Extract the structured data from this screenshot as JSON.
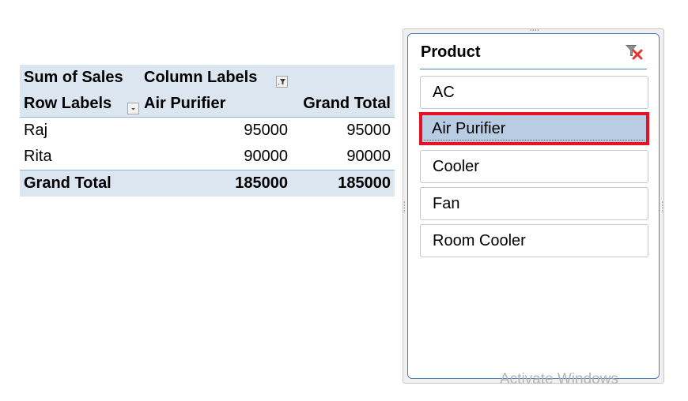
{
  "pivot": {
    "value_field": "Sum of Sales",
    "column_labels": "Column Labels",
    "row_labels": "Row Labels",
    "columns": [
      "Air Purifier",
      "Grand Total"
    ],
    "rows": [
      {
        "label": "Raj",
        "values": [
          "95000",
          "95000"
        ]
      },
      {
        "label": "Rita",
        "values": [
          "90000",
          "90000"
        ]
      }
    ],
    "grand_total": {
      "label": "Grand Total",
      "values": [
        "185000",
        "185000"
      ]
    },
    "icons": {
      "column_filter": "filter-applied-icon",
      "row_filter": "dropdown-arrow-icon"
    }
  },
  "slicer": {
    "title": "Product",
    "clear_filter_icon": "clear-filter-icon",
    "items": [
      {
        "label": "AC",
        "selected": false
      },
      {
        "label": "Air Purifier",
        "selected": true
      },
      {
        "label": "Cooler",
        "selected": false
      },
      {
        "label": "Fan",
        "selected": false
      },
      {
        "label": "Room Cooler",
        "selected": false
      }
    ],
    "highlight_color": "#e81123",
    "selected_fill": "#b8cce4"
  },
  "watermark": "Activate Windows"
}
